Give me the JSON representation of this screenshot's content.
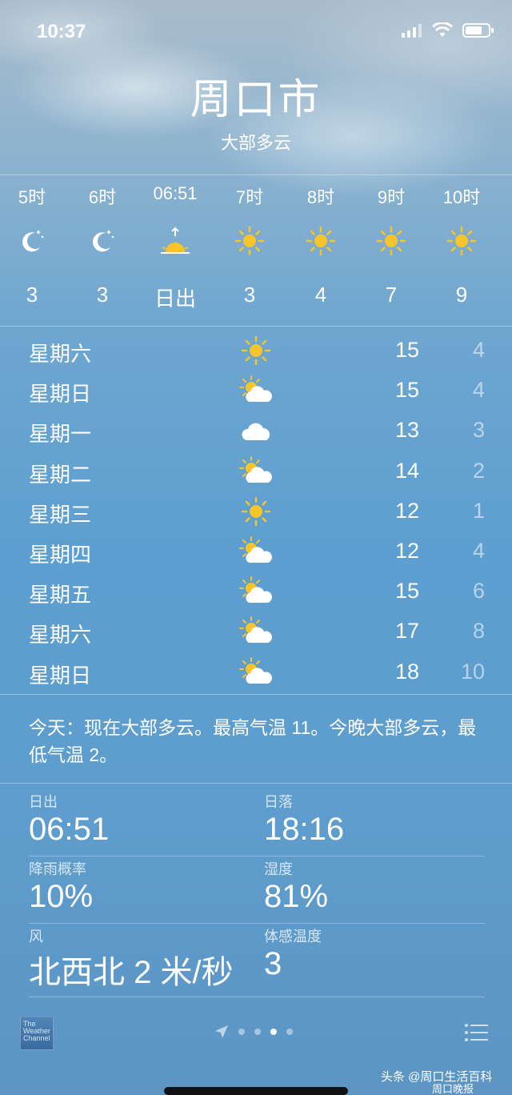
{
  "status_bar": {
    "time": "10:37"
  },
  "header": {
    "city": "周口市",
    "condition": "大部多云"
  },
  "hourly": [
    {
      "label": "5时",
      "icon": "moon-stars-icon",
      "temp": "3"
    },
    {
      "label": "6时",
      "icon": "moon-stars-icon",
      "temp": "3"
    },
    {
      "label": "06:51",
      "icon": "sunrise-icon",
      "temp": "日出"
    },
    {
      "label": "7时",
      "icon": "sun-icon",
      "temp": "3"
    },
    {
      "label": "8时",
      "icon": "sun-icon",
      "temp": "4"
    },
    {
      "label": "9时",
      "icon": "sun-icon",
      "temp": "7"
    },
    {
      "label": "10时",
      "icon": "sun-icon",
      "temp": "9"
    }
  ],
  "daily": [
    {
      "day": "星期六",
      "icon": "sun-icon",
      "high": "15",
      "low": "4"
    },
    {
      "day": "星期日",
      "icon": "partly-cloudy-icon",
      "high": "15",
      "low": "4"
    },
    {
      "day": "星期一",
      "icon": "cloud-icon",
      "high": "13",
      "low": "3"
    },
    {
      "day": "星期二",
      "icon": "partly-cloudy-icon",
      "high": "14",
      "low": "2"
    },
    {
      "day": "星期三",
      "icon": "sun-icon",
      "high": "12",
      "low": "1"
    },
    {
      "day": "星期四",
      "icon": "partly-cloudy-icon",
      "high": "12",
      "low": "4"
    },
    {
      "day": "星期五",
      "icon": "partly-cloudy-icon",
      "high": "15",
      "low": "6"
    },
    {
      "day": "星期六",
      "icon": "partly-cloudy-icon",
      "high": "17",
      "low": "8"
    },
    {
      "day": "星期日",
      "icon": "partly-cloudy-icon",
      "high": "18",
      "low": "10"
    }
  ],
  "summary": "今天：现在大部多云。最高气温 11。今晚大部多云，最低气温 2。",
  "details": {
    "sunrise_label": "日出",
    "sunrise_value": "06:51",
    "sunset_label": "日落",
    "sunset_value": "18:16",
    "rain_label": "降雨概率",
    "rain_value": "10%",
    "humidity_label": "湿度",
    "humidity_value": "81%",
    "wind_label": "风",
    "wind_value": "北西北 2 米/秒",
    "feels_label": "体感温度",
    "feels_value": "3"
  },
  "footer": {
    "logo_text": "The Weather Channel"
  },
  "watermark": {
    "line1": "头条 @周口生活百科",
    "line2": "周口晚报"
  },
  "colors": {
    "sun": "#f7c52a",
    "low_temp": "rgba(255,255,255,0.55)"
  }
}
